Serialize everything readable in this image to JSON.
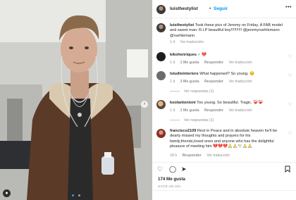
{
  "photo": {
    "alt": "Portrait photo of a young man in a shearling-collar brown leather jacket",
    "slides": 2,
    "active_slide": 1
  },
  "header": {
    "username": "luisthestylist",
    "separator": "•",
    "follow_label": "Seguir",
    "more_label": "•••"
  },
  "caption": {
    "username": "luisthestylist",
    "text": "Took these pics of Jeremy on Friday. A FAB model and sweet man. R.I.P beautiful boy!!!!!!!!!! @jeremyruehlemann @ruehlemann",
    "time": "1 d",
    "translate": "Ver traducción"
  },
  "comments": [
    {
      "username": "kikohenriques",
      "verified": true,
      "text": "💔",
      "time": "1 d",
      "likes": "1 Me gusta",
      "reply": "Responder",
      "translate": "Ver traducción"
    },
    {
      "username": "lstudiointeriors",
      "text": "What happened? So young. 😔",
      "time": "1 d",
      "likes": "3 Me gusta",
      "reply": "Responder",
      "translate": "Ver traducción",
      "replies": "Ver respuestas (1)"
    },
    {
      "username": "koolantonioni",
      "text": "Too young. So beautiful. Tragic. ❤️‍🩹❤️‍🩹",
      "time": "1 d",
      "likes": "1 Me gusta",
      "reply": "Responder",
      "translate": "Ver traducción",
      "replies": "Ver respuestas (1)"
    },
    {
      "username": "francisco2109",
      "text": "Rest in Peace and in absolute heaven he'll be dearly missed my thoughts and prayers for his family,friends,loved ones and anyone who has the delightful pleasure of meeting him 💔💔💔🙏🙏🕊️🙏🙏",
      "time": "18 h",
      "likes": "",
      "reply": "Responder",
      "translate": "Ver traducción"
    }
  ],
  "actions": {
    "like_icon": "heart-icon",
    "comment_icon": "comment-icon",
    "share_icon": "share-icon",
    "save_icon": "bookmark-icon"
  },
  "likes_count": "174 Me gusta",
  "time_ago": "HACE UN DÍA",
  "colors": {
    "link": "#0095f6",
    "muted": "#8e8e8e",
    "text": "#262626"
  }
}
